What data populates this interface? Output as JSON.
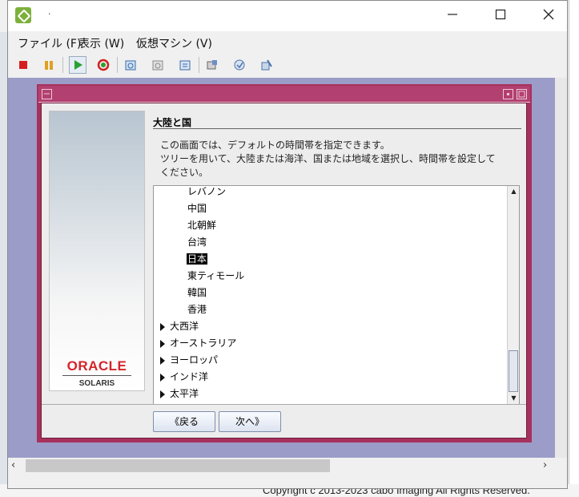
{
  "window": {
    "title": "·"
  },
  "menu": [
    {
      "label": "ファイル (F)"
    },
    {
      "label": "表示 (W)"
    },
    {
      "label": "仮想マシン (V)"
    }
  ],
  "toolbar": {
    "icons": [
      "stop-icon",
      "pause-icon",
      "play-icon",
      "reset-icon",
      "snapshot-icon",
      "revert-snapshot-icon",
      "manage-snapshots-icon",
      "settings-icon",
      "tools-icon",
      "customize-icon"
    ]
  },
  "installer": {
    "brand": {
      "logo": "ORACLE",
      "product": "SOLARIS"
    },
    "heading": "大陸と国",
    "description": [
      "この画面では、デフォルトの時間帯を指定できます。",
      "ツリーを用いて、大陸または海洋、国または地域を選択し、時間帯を設定して",
      "ください。"
    ],
    "tree": {
      "children": [
        "レバノン",
        "中国",
        "北朝鮮",
        "台湾",
        "日本",
        "東ティモール",
        "韓国",
        "香港"
      ],
      "selected": "日本",
      "groups": [
        "大西洋",
        "オーストラリア",
        "ヨーロッパ",
        "インド洋",
        "太平洋"
      ]
    },
    "buttons": {
      "back": "戻る",
      "next": "次へ"
    }
  },
  "footer": {
    "copyright": "Copyright c 2013-2023 cabo Imaging All Rights Reserved."
  },
  "colors": {
    "dialog_frame": "#a7315d",
    "vm_background": "#9c9cc8",
    "oracle_red": "#d4242a"
  }
}
